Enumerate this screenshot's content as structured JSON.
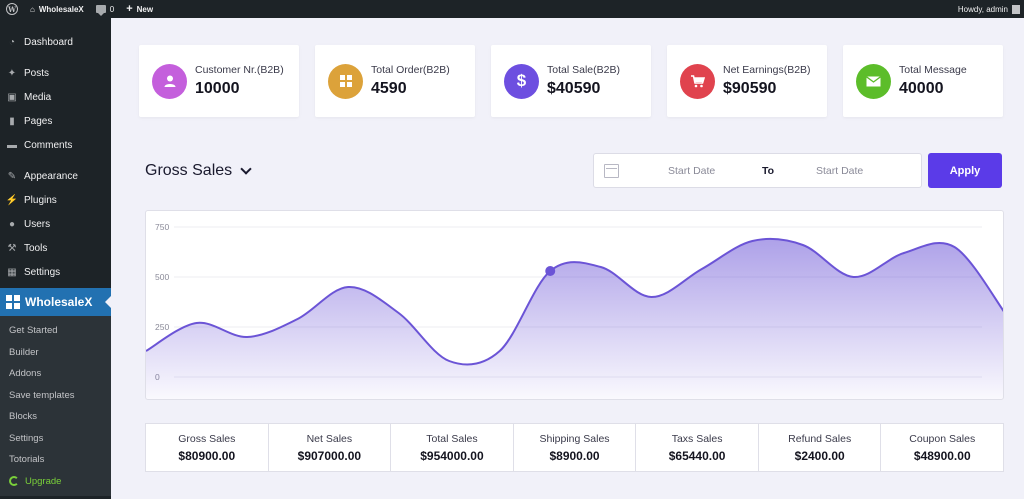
{
  "adminbar": {
    "site_name": "WholesaleX",
    "comments_count": "0",
    "new_label": "New",
    "greeting": "Howdy, admin"
  },
  "sidebar": {
    "items": [
      {
        "label": "Dashboard",
        "icon": "dashboard-icon"
      },
      {
        "label": "Posts",
        "icon": "pin-icon"
      },
      {
        "label": "Media",
        "icon": "media-icon"
      },
      {
        "label": "Pages",
        "icon": "pages-icon"
      },
      {
        "label": "Comments",
        "icon": "comments-icon"
      },
      {
        "label": "Appearance",
        "icon": "brush-icon"
      },
      {
        "label": "Plugins",
        "icon": "plugin-icon"
      },
      {
        "label": "Users",
        "icon": "users-icon"
      },
      {
        "label": "Tools",
        "icon": "wrench-icon"
      },
      {
        "label": "Settings",
        "icon": "settings-icon"
      }
    ],
    "active": {
      "label": "WholesaleX",
      "icon": "wholesalex-logo-icon"
    },
    "submenu": [
      "Get Started",
      "Builder",
      "Addons",
      "Save templates",
      "Blocks",
      "Settings",
      "Totorials",
      "Upgrade"
    ]
  },
  "cards": [
    {
      "label": "Customer Nr.(B2B)",
      "value": "10000",
      "color": "#c45fdc",
      "icon": "user-icon"
    },
    {
      "label": "Total Order(B2B)",
      "value": "4590",
      "color": "#dca23a",
      "icon": "grid-icon"
    },
    {
      "label": "Total Sale(B2B)",
      "value": "$40590",
      "color": "#6d4fe0",
      "icon": "dollar-icon"
    },
    {
      "label": "Net Earnings(B2B)",
      "value": "$90590",
      "color": "#e0434e",
      "icon": "cart-icon"
    },
    {
      "label": "Total Message",
      "value": "40000",
      "color": "#5cbd2a",
      "icon": "mail-icon"
    }
  ],
  "section": {
    "title": "Gross Sales"
  },
  "date_filter": {
    "start_placeholder": "Start Date",
    "separator": "To",
    "end_placeholder": "Start Date",
    "apply_label": "Apply"
  },
  "chart_data": {
    "type": "area",
    "y_ticks": [
      "750",
      "500",
      "250",
      "0"
    ],
    "ylim": [
      0,
      750
    ],
    "x": [
      0,
      1,
      2,
      3,
      4,
      5,
      6,
      7,
      8,
      9,
      10,
      11,
      12,
      13,
      14,
      15,
      16,
      17
    ],
    "values": [
      130,
      270,
      200,
      290,
      450,
      320,
      80,
      130,
      530,
      550,
      400,
      540,
      680,
      660,
      500,
      620,
      650,
      320
    ],
    "highlight_index": 8,
    "color": "#6b54d6",
    "grid": true
  },
  "stats": [
    {
      "label": "Gross Sales",
      "value": "$80900.00"
    },
    {
      "label": "Net Sales",
      "value": "$907000.00"
    },
    {
      "label": "Total Sales",
      "value": "$954000.00"
    },
    {
      "label": "Shipping Sales",
      "value": "$8900.00"
    },
    {
      "label": "Taxs Sales",
      "value": "$65440.00"
    },
    {
      "label": "Refund Sales",
      "value": "$2400.00"
    },
    {
      "label": "Coupon Sales",
      "value": "$48900.00"
    }
  ]
}
